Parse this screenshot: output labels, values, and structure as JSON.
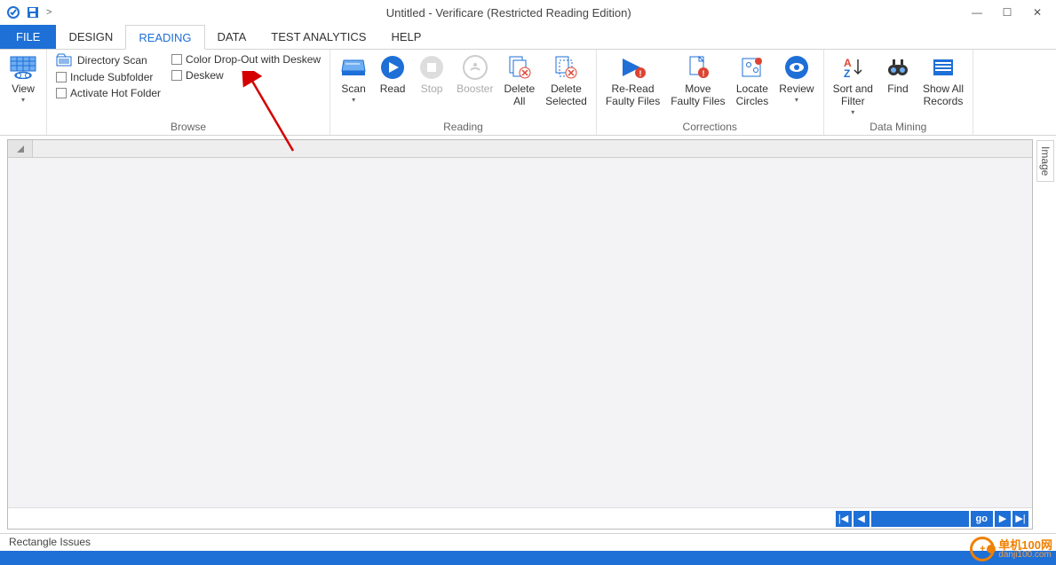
{
  "title": "Untitled - Verificare (Restricted Reading Edition)",
  "qat_marker": ">",
  "tabs": {
    "file": "FILE",
    "design": "DESIGN",
    "reading": "READING",
    "data": "DATA",
    "analytics": "TEST ANALYTICS",
    "help": "HELP"
  },
  "ribbon": {
    "view": "View",
    "browse": {
      "directory_scan": "Directory Scan",
      "color_dropout": "Color Drop-Out with Deskew",
      "include_subfolder": "Include Subfolder",
      "deskew": "Deskew",
      "activate_hot": "Activate Hot Folder",
      "group": "Browse"
    },
    "reading": {
      "scan": "Scan",
      "read": "Read",
      "stop": "Stop",
      "booster": "Booster",
      "delete_all": "Delete\nAll",
      "delete_selected": "Delete\nSelected",
      "group": "Reading"
    },
    "corrections": {
      "reread": "Re-Read\nFaulty Files",
      "move": "Move\nFaulty Files",
      "locate": "Locate\nCircles",
      "review": "Review",
      "group": "Corrections"
    },
    "mining": {
      "sort": "Sort and\nFilter",
      "find": "Find",
      "show_all": "Show All\nRecords",
      "group": "Data Mining"
    }
  },
  "side_tab": "Image",
  "nav": {
    "go": "go"
  },
  "issues": "Rectangle Issues",
  "watermark": {
    "cn": "单机100网",
    "en": "danji100.com"
  }
}
